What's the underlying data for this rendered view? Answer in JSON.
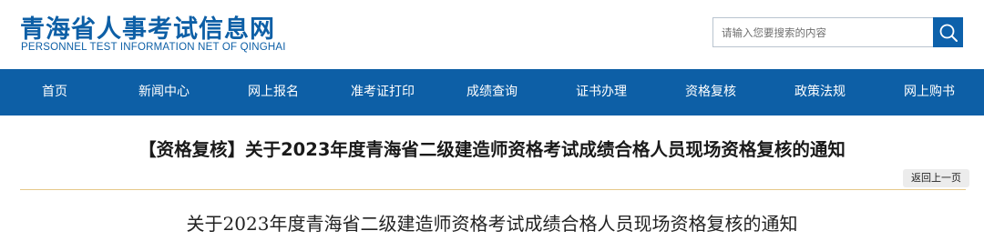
{
  "header": {
    "site_name": "青海省人事考试信息网",
    "site_name_en": "PERSONNEL TEST INFORMATION NET OF QINGHAI"
  },
  "search": {
    "placeholder": "请输入您要搜索的内容",
    "icon": "search-icon"
  },
  "nav": {
    "items": [
      {
        "label": "首页"
      },
      {
        "label": "新闻中心"
      },
      {
        "label": "网上报名"
      },
      {
        "label": "准考证打印"
      },
      {
        "label": "成绩查询"
      },
      {
        "label": "证书办理"
      },
      {
        "label": "资格复核"
      },
      {
        "label": "政策法规"
      },
      {
        "label": "网上购书"
      }
    ]
  },
  "article": {
    "title": "【资格复核】关于2023年度青海省二级建造师资格考试成绩合格人员现场资格复核的通知",
    "back_label": "返回上一页",
    "heading": "关于2023年度青海省二级建造师资格考试成绩合格人员现场资格复核的通知"
  },
  "colors": {
    "brand_blue": "#0d5fa6",
    "divider_gold": "#e6c98a"
  }
}
